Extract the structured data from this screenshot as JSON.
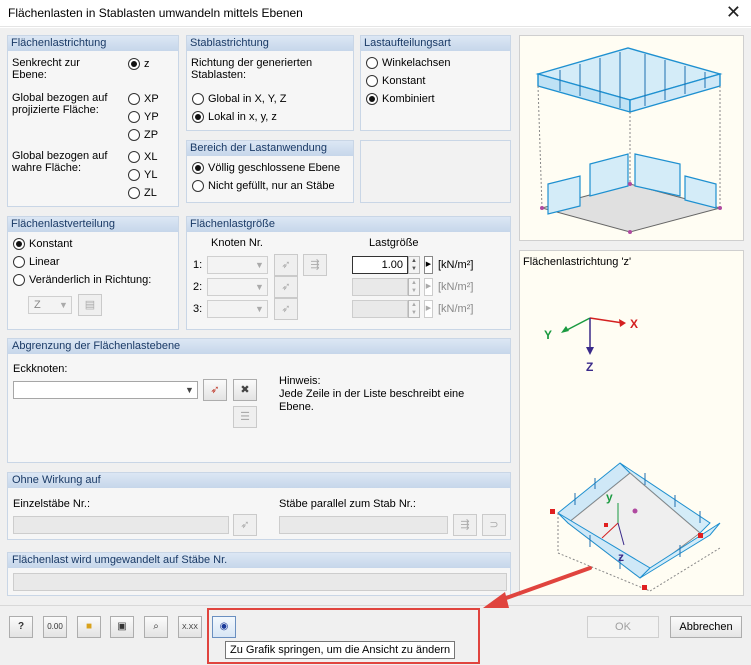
{
  "window": {
    "title": "Flächenlasten in Stablasten umwandeln mittels Ebenen",
    "close_glyph": "✕"
  },
  "direction": {
    "header": "Flächenlastrichtung",
    "perp_label": "Senkrecht zur\nEbene:",
    "perp_option": "z",
    "global_proj_label": "Global bezogen auf\nprojizierte Fläche:",
    "proj_options": [
      "XP",
      "YP",
      "ZP"
    ],
    "global_true_label": "Global bezogen auf\nwahre Fläche:",
    "true_options": [
      "XL",
      "YL",
      "ZL"
    ],
    "selected": "z"
  },
  "bar_direction": {
    "header": "Stablastrichtung",
    "label": "Richtung der generierten\nStablasten:",
    "options": [
      "Global in X, Y, Z",
      "Lokal in x, y, z"
    ],
    "selected": "Lokal in x, y, z"
  },
  "distribution_type": {
    "header": "Lastaufteilungsart",
    "options": [
      "Winkelachsen",
      "Konstant",
      "Kombiniert"
    ],
    "selected": "Kombiniert"
  },
  "load_area": {
    "header": "Bereich der Lastanwendung",
    "options": [
      "Völlig geschlossene Ebene",
      "Nicht gefüllt, nur an Stäbe"
    ],
    "selected": "Völlig geschlossene Ebene"
  },
  "area_distribution": {
    "header": "Flächenlastverteilung",
    "options": [
      "Konstant",
      "Linear",
      "Veränderlich in Richtung:"
    ],
    "selected": "Konstant",
    "direction_value": "Z"
  },
  "magnitude": {
    "header": "Flächenlastgröße",
    "node_header": "Knoten Nr.",
    "value_header": "Lastgröße",
    "rows": [
      {
        "label": "1:",
        "value": "1.00",
        "unit": "[kN/m²]"
      },
      {
        "label": "2:",
        "value": "",
        "unit": "[kN/m²]"
      },
      {
        "label": "3:",
        "value": "",
        "unit": "[kN/m²]"
      }
    ]
  },
  "boundary": {
    "header": "Abgrenzung der Flächenlastebene",
    "corner_label": "Eckknoten:",
    "hint_title": "Hinweis:",
    "hint_text": "Jede Zeile in der Liste beschreibt eine\nEbene."
  },
  "no_effect": {
    "header": "Ohne Wirkung auf",
    "single_label": "Einzelstäbe Nr.:",
    "parallel_label": "Stäbe parallel zum Stab Nr.:"
  },
  "converted": {
    "header": "Flächenlast wird umgewandelt auf Stäbe Nr."
  },
  "preview": {
    "caption": "Flächenlastrichtung 'z'",
    "axis_x": "X",
    "axis_y": "Y",
    "axis_z": "Z",
    "local_y": "y",
    "local_z": "z"
  },
  "footer": {
    "ok": "OK",
    "cancel": "Abbrechen",
    "units_badge": "0.00",
    "xxx_badge": "X.XX"
  },
  "tooltip": "Zu Grafik springen, um die Ansicht zu ändern",
  "colors": {
    "accent": "#1e90d0",
    "highlight": "#e0443e",
    "header_text": "#1a3a66"
  }
}
